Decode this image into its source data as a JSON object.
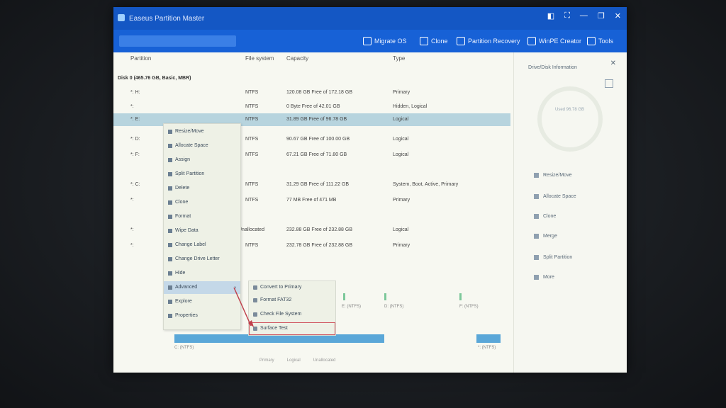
{
  "app": {
    "title": "Easeus Partition Master",
    "controls": [
      "◧",
      "⛶",
      "—",
      "❐",
      "✕"
    ]
  },
  "toolbar": {
    "items": [
      "Migrate OS",
      "Clone",
      "Partition Recovery",
      "WinPE Creator",
      "Tools"
    ]
  },
  "columns": [
    "Partition",
    "File system",
    "Capacity",
    "Type"
  ],
  "disk0": {
    "label": "Disk 0 (465.76 GB, Basic, MBR)"
  },
  "rows": [
    {
      "name": "*: H:",
      "fs": "NTFS",
      "cap": "120.08 GB Free of 172.18 GB",
      "type": "Primary"
    },
    {
      "name": "*:",
      "fs": "NTFS",
      "cap": "0 Byte Free of 42.01 GB",
      "type": "Hidden, Logical"
    },
    {
      "name": "*: E:",
      "fs": "NTFS",
      "cap": "31.89 GB Free of 96.78 GB",
      "type": "Logical"
    },
    {
      "name": "*: D:",
      "fs": "NTFS",
      "cap": "90.67 GB Free of 100.00 GB",
      "type": "Logical"
    },
    {
      "name": "*: F:",
      "fs": "NTFS",
      "cap": "67.21 GB Free of 71.80 GB",
      "type": "Logical"
    },
    {
      "name": "*: C:",
      "fs": "NTFS",
      "cap": "31.29 GB Free of 111.22 GB",
      "type": "System, Boot, Active, Primary"
    },
    {
      "name": "*:",
      "fs": "NTFS",
      "cap": "77 MB Free of 471 MB",
      "type": "Primary"
    },
    {
      "name": "*:",
      "fs": "Unallocated",
      "cap": "232.88 GB Free of 232.88 GB",
      "type": "Logical"
    },
    {
      "name": "*:",
      "fs": "NTFS",
      "cap": "232.78 GB Free of 232.88 GB",
      "type": "Primary"
    }
  ],
  "context_menu": [
    "Resize/Move",
    "Allocate Space",
    "Assign",
    "Split Partition",
    "Delete",
    "Clone",
    "Format",
    "Wipe Data",
    "Change Label",
    "Change Drive Letter",
    "Hide",
    "Advanced",
    "Explore",
    "Properties"
  ],
  "submenu": [
    "Convert to Primary",
    "Format FAT32",
    "Check File System",
    "Surface Test"
  ],
  "disk_map": {
    "labels": [
      "E: (NTFS)",
      "D: (NTFS)",
      "F: (NTFS)"
    ],
    "bottom_label": "C: (NTFS)",
    "right_label": "*: (NTFS)"
  },
  "right_panel": {
    "title": "Drive/Disk Information",
    "usage": "Used 96.78 GB",
    "actions": [
      "Resize/Move",
      "Allocate Space",
      "Clone",
      "Merge",
      "Split Partition",
      "More"
    ]
  },
  "statusbar": [
    "Primary",
    "Logical",
    "Unallocated"
  ]
}
